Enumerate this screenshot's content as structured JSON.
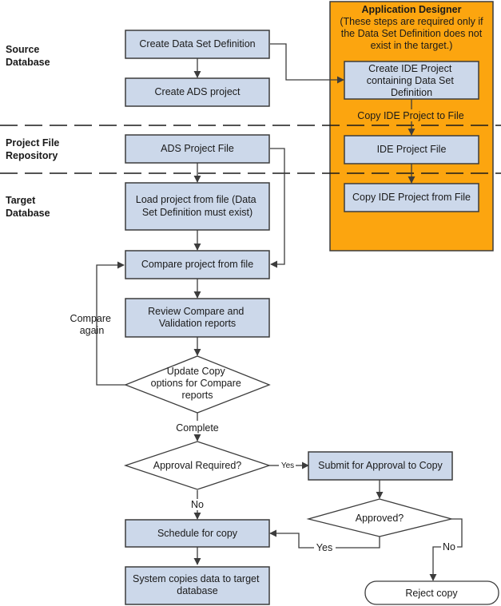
{
  "lanes": {
    "source": [
      "Source",
      "Database"
    ],
    "repository": [
      "Project File",
      "Repository"
    ],
    "target": [
      "Target",
      "Database"
    ]
  },
  "app_designer": {
    "title": "Application Designer",
    "note": [
      "(These steps are required only if",
      "the Data Set Definition does not",
      "exist in the target.)"
    ],
    "steps": {
      "create_ide": [
        "Create IDE Project",
        "containing Data Set",
        "Definition"
      ],
      "copy_to_file_label": "Copy IDE Project to File",
      "ide_file": "IDE Project File",
      "copy_from_file": "Copy IDE Project from File"
    }
  },
  "steps": {
    "create_dsd": "Create Data Set Definition",
    "create_ads": "Create ADS project",
    "ads_file": "ADS Project File",
    "load_project": [
      "Load project from file (Data",
      "Set Definition must exist)"
    ],
    "compare_project": "Compare project from file",
    "review_reports": [
      "Review Compare and",
      "Validation reports"
    ],
    "update_copy": [
      "Update Copy",
      "options for Compare",
      "reports"
    ],
    "approval_required": "Approval Required?",
    "submit_approval": "Submit for Approval to Copy",
    "approved": "Approved?",
    "schedule_copy": "Schedule for copy",
    "system_copies": [
      "System copies data to target",
      "database"
    ],
    "reject_copy": "Reject copy"
  },
  "edge_labels": {
    "compare_again": [
      "Compare",
      "again"
    ],
    "complete": "Complete",
    "yes_approval": "Yes",
    "no_approval": "No",
    "yes_approved": "Yes",
    "no_approved": "No"
  },
  "colors": {
    "box_fill": "#ccd8ea",
    "orange_panel": "#fca50f",
    "stroke": "#3c3c3c"
  }
}
